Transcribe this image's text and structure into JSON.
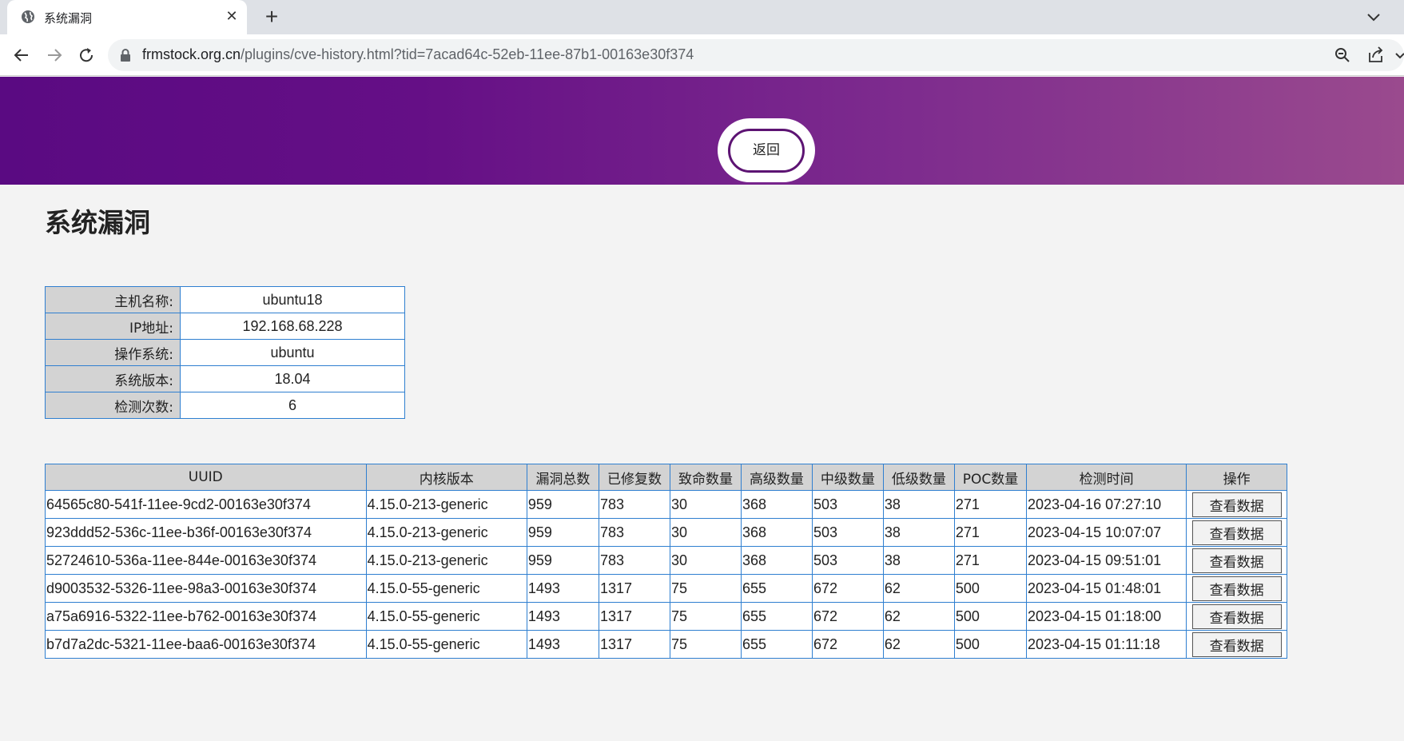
{
  "browser": {
    "tab_title": "系统漏洞",
    "url_domain": "frmstock.org.cn",
    "url_path": "/plugins/cve-history.html?tid=7acad64c-52eb-11ee-87b1-00163e30f374"
  },
  "banner": {
    "back_label": "返回"
  },
  "page_title": "系统漏洞",
  "host_info": [
    {
      "label": "主机名称:",
      "value": "ubuntu18"
    },
    {
      "label": "IP地址:",
      "value": "192.168.68.228"
    },
    {
      "label": "操作系统:",
      "value": "ubuntu"
    },
    {
      "label": "系统版本:",
      "value": "18.04"
    },
    {
      "label": "检测次数:",
      "value": "6"
    }
  ],
  "history_table": {
    "headers": [
      "UUID",
      "内核版本",
      "漏洞总数",
      "已修复数",
      "致命数量",
      "高级数量",
      "中级数量",
      "低级数量",
      "POC数量",
      "检测时间",
      "操作"
    ],
    "action_label": "查看数据",
    "rows": [
      [
        "64565c80-541f-11ee-9cd2-00163e30f374",
        "4.15.0-213-generic",
        "959",
        "783",
        "30",
        "368",
        "503",
        "38",
        "271",
        "2023-04-16 07:27:10"
      ],
      [
        "923ddd52-536c-11ee-b36f-00163e30f374",
        "4.15.0-213-generic",
        "959",
        "783",
        "30",
        "368",
        "503",
        "38",
        "271",
        "2023-04-15 10:07:07"
      ],
      [
        "52724610-536a-11ee-844e-00163e30f374",
        "4.15.0-213-generic",
        "959",
        "783",
        "30",
        "368",
        "503",
        "38",
        "271",
        "2023-04-15 09:51:01"
      ],
      [
        "d9003532-5326-11ee-98a3-00163e30f374",
        "4.15.0-55-generic",
        "1493",
        "1317",
        "75",
        "655",
        "672",
        "62",
        "500",
        "2023-04-15 01:48:01"
      ],
      [
        "a75a6916-5322-11ee-b762-00163e30f374",
        "4.15.0-55-generic",
        "1493",
        "1317",
        "75",
        "655",
        "672",
        "62",
        "500",
        "2023-04-15 01:18:00"
      ],
      [
        "b7d7a2dc-5321-11ee-baa6-00163e30f374",
        "4.15.0-55-generic",
        "1493",
        "1317",
        "75",
        "655",
        "672",
        "62",
        "500",
        "2023-04-15 01:11:18"
      ]
    ]
  },
  "colors": {
    "banner_start": "#5a0a82",
    "banner_end": "#9a4a8e",
    "table_border": "#2f7fd0",
    "header_bg": "#d3d3d3"
  }
}
